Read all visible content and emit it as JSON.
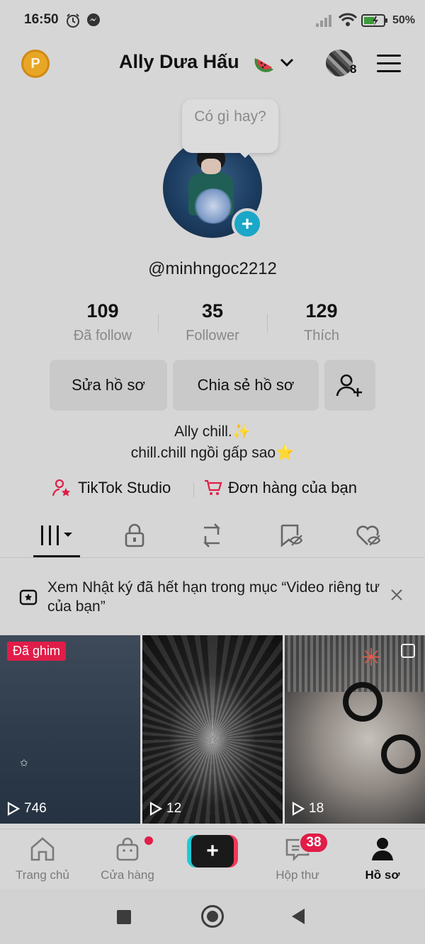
{
  "status_bar": {
    "time": "16:50",
    "battery_percent": "50%"
  },
  "header": {
    "username": "Ally Dưa Hấu",
    "coin_letter": "P",
    "account_count": "8"
  },
  "profile": {
    "bubble_text": "Có gì hay?",
    "handle": "@minhngoc2212",
    "stats": [
      {
        "value": "109",
        "label": "Đã follow"
      },
      {
        "value": "35",
        "label": "Follower"
      },
      {
        "value": "129",
        "label": "Thích"
      }
    ],
    "buttons": {
      "edit": "Sửa hồ sơ",
      "share": "Chia sẻ hồ sơ"
    },
    "bio_line1": "Ally chill.✨",
    "bio_line2": "chill.chill ngồi gấp sao⭐"
  },
  "links": {
    "studio": "TikTok Studio",
    "orders": "Đơn hàng của bạn"
  },
  "tabs": [
    "videos-grid-icon",
    "lock-icon",
    "repost-icon",
    "favorites-icon",
    "liked-icon"
  ],
  "banner": {
    "text": "Xem Nhật ký đã hết hạn trong mục “Video riêng tư của bạn”"
  },
  "videos": [
    {
      "pinned_label": "Đã ghim",
      "views": "746"
    },
    {
      "views": "12"
    },
    {
      "views": "18"
    }
  ],
  "bottom_nav": {
    "home": "Trang chủ",
    "shop": "Cửa hàng",
    "inbox": "Hộp thư",
    "inbox_badge": "38",
    "profile": "Hồ sơ"
  },
  "colors": {
    "accent": "#e11d48",
    "teal": "#20c9d4",
    "plus_badge": "#1aa7c8"
  }
}
